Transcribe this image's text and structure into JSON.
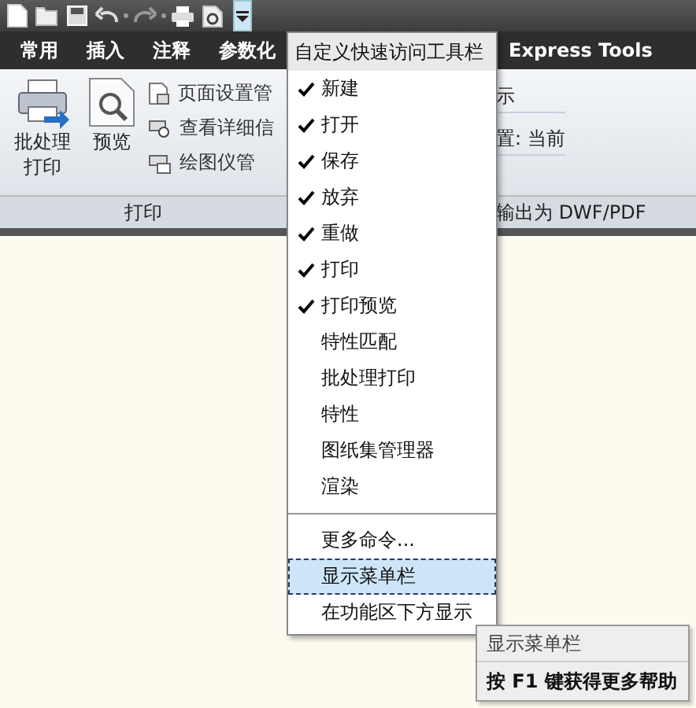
{
  "quick_access_toolbar": {
    "customize_open": true
  },
  "tabs": [
    {
      "label": "常用",
      "selected": false
    },
    {
      "label": "插入",
      "selected": false
    },
    {
      "label": "注释",
      "selected": false
    },
    {
      "label": "参数化",
      "selected": false
    },
    {
      "label": "Express Tools",
      "selected": false
    }
  ],
  "ribbon": {
    "plot_panel": {
      "large_buttons": [
        {
          "label": "批处理打印",
          "kind": "batch"
        },
        {
          "label": "预览",
          "kind": "preview"
        }
      ],
      "small_buttons": [
        {
          "label": "页面设置管",
          "kind": "page"
        },
        {
          "label": "查看详细信",
          "kind": "details"
        },
        {
          "label": "绘图仪管",
          "kind": "plotter"
        }
      ],
      "title": "打印"
    },
    "export_panel": {
      "rows": [
        "示",
        "置: 当前"
      ],
      "title": "输出为 DWF/PDF"
    }
  },
  "menu": {
    "title": "自定义快速访问工具栏",
    "toggles": [
      {
        "label": "新建",
        "checked": true
      },
      {
        "label": "打开",
        "checked": true
      },
      {
        "label": "保存",
        "checked": true
      },
      {
        "label": "放弃",
        "checked": true
      },
      {
        "label": "重做",
        "checked": true
      },
      {
        "label": "打印",
        "checked": true
      },
      {
        "label": "打印预览",
        "checked": true
      },
      {
        "label": "特性匹配",
        "checked": false
      },
      {
        "label": "批处理打印",
        "checked": false
      },
      {
        "label": "特性",
        "checked": false
      },
      {
        "label": "图纸集管理器",
        "checked": false
      },
      {
        "label": "渲染",
        "checked": false
      }
    ],
    "commands": [
      {
        "label": "更多命令...",
        "selected": false
      },
      {
        "label": "显示菜单栏",
        "selected": true
      },
      {
        "label": "在功能区下方显示",
        "selected": false
      }
    ]
  },
  "tooltip": {
    "title": "显示菜单栏",
    "hint": "按 F1 键获得更多帮助"
  }
}
